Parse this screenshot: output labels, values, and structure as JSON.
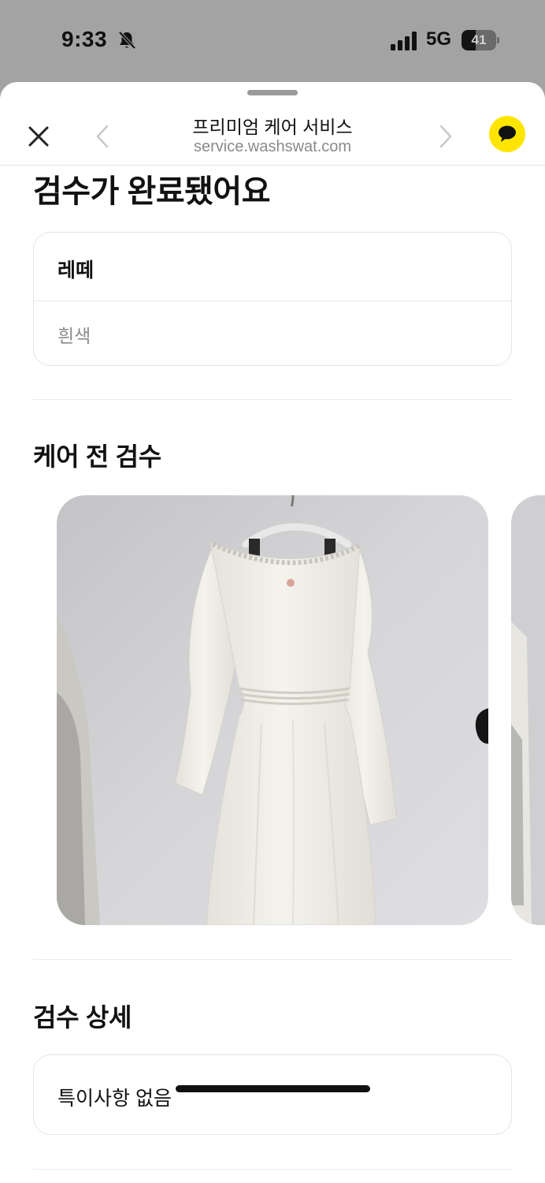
{
  "status_bar": {
    "time": "9:33",
    "network": "5G",
    "battery_percent": 41,
    "battery_label": "41",
    "icons": [
      "bell-slash-icon",
      "cellular-signal-icon",
      "battery-icon"
    ]
  },
  "nav": {
    "title": "프리미엄 케어 서비스",
    "url": "service.washswat.com",
    "icons": [
      "close-icon",
      "chevron-left-icon",
      "chevron-right-icon",
      "chat-bubble-icon"
    ],
    "chat_button_color": "#FEE500"
  },
  "page": {
    "title": "검수가 완료됐어요"
  },
  "item": {
    "brand": "레떼",
    "color": "흰색"
  },
  "inspection": {
    "title": "케어 전 검수",
    "photos": [
      "white-dress-on-hanger-photo",
      "next-photo-preview"
    ]
  },
  "details": {
    "title": "검수 상세",
    "note": "특이사항 없음"
  }
}
